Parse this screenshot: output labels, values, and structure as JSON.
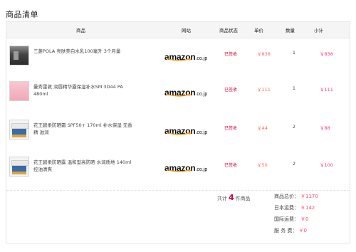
{
  "title": "商品清单",
  "headers": {
    "product": "商品",
    "shop": "网站",
    "status": "商品状态",
    "price": "单价",
    "qty": "数量",
    "subtotal": "小计"
  },
  "items": [
    {
      "name": "三菱POLA 亮肤美白水乳100毫升 3个月量",
      "shop_main": "amazon",
      "shop_tld": ".co.jp",
      "status": "已签收",
      "price": "￥838",
      "qty": "1",
      "subtotal": "￥838",
      "thumb": "dark"
    },
    {
      "name": "曼秀雷敦 润唇精华露保湿补水SM 3D44 PA 480ml",
      "shop_main": "amazon",
      "shop_tld": ".co.jp",
      "status": "已签收",
      "price": "￥111",
      "qty": "1",
      "subtotal": "￥111",
      "thumb": "pink"
    },
    {
      "name": "花王碧柔防晒霜 SPF50+ 170ml 补水保湿 无香精 滋润",
      "shop_main": "amazon",
      "shop_tld": ".co.jp",
      "status": "已签收",
      "price": "￥44",
      "qty": "2",
      "subtotal": "￥88",
      "thumb": "jar"
    },
    {
      "name": "花王碧柔防晒露 温和型高防晒 水润质地 140ml 控油清爽",
      "shop_main": "amazon",
      "shop_tld": ".co.jp",
      "status": "已签收",
      "price": "￥50",
      "qty": "2",
      "subtotal": "￥100",
      "thumb": "jar"
    }
  ],
  "summary": {
    "count_prefix": "共计",
    "count": "4",
    "count_suffix": "件商品",
    "goods_label": "商品总价：",
    "goods_value": "￥1170",
    "shipping_label": "日本运费：",
    "shipping_value": "￥142",
    "ems_label": "国际运费：",
    "ems_value": "￥0",
    "service_label": "服 务 费：",
    "service_value": "￥0"
  },
  "colors": {
    "accent": "#d9003b",
    "price": "#ff6a6a",
    "amazon_orange": "#ff9900"
  }
}
